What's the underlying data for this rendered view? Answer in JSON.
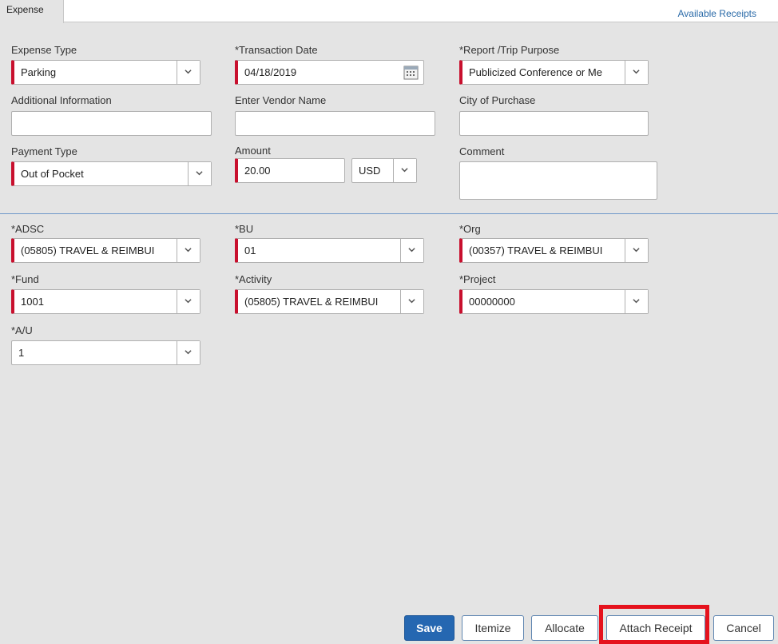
{
  "tab": {
    "label": "Expense"
  },
  "available_receipts": "Available Receipts",
  "fields": {
    "expense_type": {
      "label": "Expense Type",
      "value": "Parking"
    },
    "transaction_date": {
      "label": "*Transaction Date",
      "value": "04/18/2019"
    },
    "report_purpose": {
      "label": "*Report /Trip Purpose",
      "value": "Publicized Conference or Me"
    },
    "additional_info": {
      "label": "Additional Information",
      "value": ""
    },
    "vendor_name": {
      "label": "Enter Vendor Name",
      "value": ""
    },
    "city_of_purchase": {
      "label": "City of Purchase",
      "value": ""
    },
    "payment_type": {
      "label": "Payment Type",
      "value": "Out of Pocket"
    },
    "amount": {
      "label": "Amount",
      "value": "20.00",
      "currency": "USD"
    },
    "comment": {
      "label": "Comment",
      "value": ""
    },
    "adsc": {
      "label": "*ADSC",
      "value": "(05805) TRAVEL & REIMBUI"
    },
    "bu": {
      "label": "*BU",
      "value": "01"
    },
    "org": {
      "label": "*Org",
      "value": "(00357) TRAVEL & REIMBUI"
    },
    "fund": {
      "label": "*Fund",
      "value": "1001"
    },
    "activity": {
      "label": "*Activity",
      "value": "(05805) TRAVEL & REIMBUI"
    },
    "project": {
      "label": "*Project",
      "value": "00000000"
    },
    "au": {
      "label": "*A/U",
      "value": "1"
    }
  },
  "buttons": {
    "save": "Save",
    "itemize": "Itemize",
    "allocate": "Allocate",
    "attach_receipt": "Attach Receipt",
    "cancel": "Cancel"
  },
  "colors": {
    "required_marker": "#c8102e",
    "primary_button": "#2567b1",
    "highlight_box": "#e5121d",
    "link": "#2a6aa8"
  }
}
